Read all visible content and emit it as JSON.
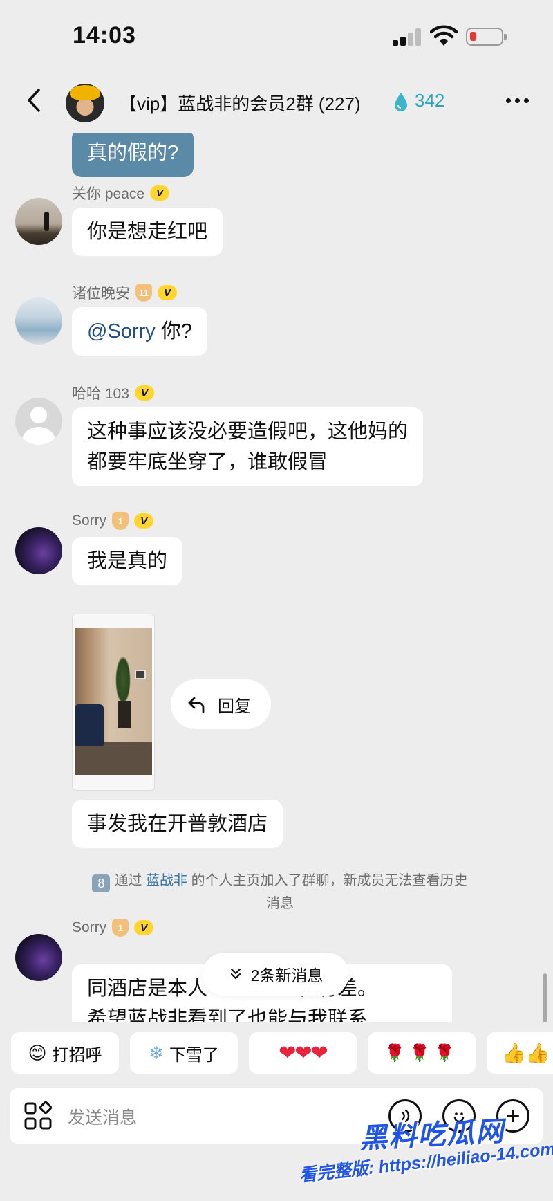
{
  "status_bar": {
    "time": "14:03"
  },
  "header": {
    "title": "【vip】蓝战非的会员2群 (227)",
    "score": "342",
    "accent_color": "#2aa6c0"
  },
  "messages": [
    {
      "type": "bubble",
      "text": "真的假的?",
      "style": "blue"
    },
    {
      "type": "user",
      "name": "关你 peace",
      "badges": [
        "V"
      ],
      "text": "你是想走红吧"
    },
    {
      "type": "user",
      "name": "诸位晚安",
      "level": "11",
      "badges": [
        "V"
      ],
      "mention": "@Sorry",
      "text": "你?"
    },
    {
      "type": "user",
      "name": "哈哈 103",
      "badges": [
        "V"
      ],
      "lines": [
        "这种事应该没必要造假吧，这他妈的",
        "都要牢底坐穿了，谁敢假冒"
      ]
    },
    {
      "type": "user",
      "name": "Sorry",
      "level": "1",
      "badges": [
        "V"
      ],
      "text": "我是真的",
      "text2": "事发我在开普敦酒店"
    },
    {
      "type": "user",
      "name": "Sorry",
      "level": "1",
      "badges": [
        "V"
      ],
      "lines": [
        "同酒店是本人",
        "程有差。",
        "希望蓝战非看到了也能与我联系"
      ]
    }
  ],
  "reply_pill": {
    "label": "回复"
  },
  "system_notice": {
    "badge": "8",
    "prefix": "通过",
    "link": "蓝战非",
    "suffix": "的个人主页加入了群聊，新成员无法查看历史",
    "line2": "消息"
  },
  "new_messages_pill": {
    "label": "2条新消息"
  },
  "quick_replies": [
    {
      "label": "打招呼",
      "icon": "wave-emoji"
    },
    {
      "label": "下雪了",
      "icon": "snowflake-emoji"
    },
    {
      "label": "❤❤❤",
      "icon": "hearts"
    },
    {
      "label": "🌹🌹🌹",
      "icon": "roses"
    },
    {
      "label": "👍👍",
      "icon": "thumbs-up"
    }
  ],
  "input": {
    "placeholder": "发送消息"
  },
  "watermark": {
    "brand": "黑料吃瓜网",
    "url": "看完整版: https://heiliao-14.com"
  }
}
